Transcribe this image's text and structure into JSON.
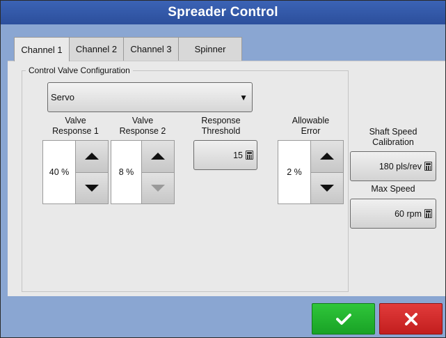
{
  "window": {
    "title": "Spreader Control"
  },
  "tabs": [
    {
      "label": "Channel 1",
      "active": true
    },
    {
      "label": "Channel 2",
      "active": false
    },
    {
      "label": "Channel 3",
      "active": false
    },
    {
      "label": "Spinner",
      "active": false
    }
  ],
  "group": {
    "legend": "Control Valve Configuration"
  },
  "valve_type": {
    "selected": "Servo"
  },
  "valve_response_1": {
    "label_line1": "Valve",
    "label_line2": "Response 1",
    "value": "40 %"
  },
  "valve_response_2": {
    "label_line1": "Valve",
    "label_line2": "Response 2",
    "value": "8 %",
    "down_enabled": false
  },
  "response_threshold": {
    "label_line1": "Response",
    "label_line2": "Threshold",
    "value": "15"
  },
  "allowable_error": {
    "label_line1": "Allowable",
    "label_line2": "Error",
    "value": "2 %"
  },
  "shaft_speed": {
    "label_line1": "Shaft Speed",
    "label_line2": "Calibration",
    "value": "180 pls/rev"
  },
  "max_speed": {
    "label": "Max Speed",
    "value": "60 rpm"
  },
  "actions": {
    "ok_icon": "checkmark-icon",
    "cancel_icon": "x-icon"
  },
  "colors": {
    "title_bar": "#2c4f9c",
    "ok": "#19a226",
    "cancel": "#c21e1e",
    "frame": "#8aa6d2"
  }
}
